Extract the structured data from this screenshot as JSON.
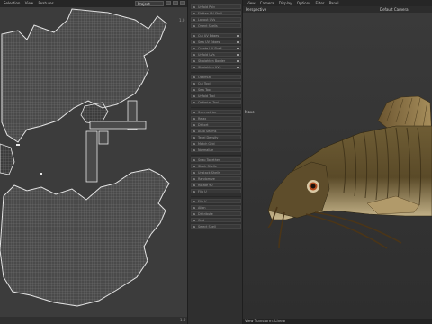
{
  "uv_editor": {
    "menu": [
      "Selection",
      "View",
      "Features"
    ],
    "projection_select": "Project",
    "corner_top": "1.0",
    "corner_bottom": "1.0"
  },
  "tool_panel": {
    "items": [
      "Unfold Poly",
      "Flatten UV Shell",
      "Layout UVs",
      "Orient Shells",
      "Cut UV Edges",
      "Sew UV Edges",
      "Create UV Shell",
      "Unfold UVs",
      "Straighten Border",
      "Straighten UVs",
      "Optimize",
      "Cut Tool",
      "Sew Tool",
      "Unfold Tool",
      "Optimize Tool",
      "Symmetrize",
      "Relax",
      "Distort",
      "Auto Seams",
      "Texel Density",
      "Match Grid",
      "Normalize",
      "Snap Together",
      "Stack Shells",
      "Unstack Shells",
      "Randomize",
      "Rotate 90",
      "Flip U",
      "Flip V",
      "Align",
      "Distribute",
      "Grid",
      "Select Shell"
    ]
  },
  "viewport": {
    "menu": [
      "View",
      "Camera",
      "Display",
      "Options",
      "Filter",
      "Panel"
    ],
    "label_left": "Perspective",
    "camera_label": "Default Camera",
    "move_label": "Move",
    "status_text": "View Transform: Linear"
  },
  "colors": {
    "uv_bg": "#3c3c3c",
    "uv_shell": "#474747",
    "uv_border": "#e8e8e8",
    "fish_body": "#6b5a33",
    "fish_belly": "#c9b88e"
  }
}
